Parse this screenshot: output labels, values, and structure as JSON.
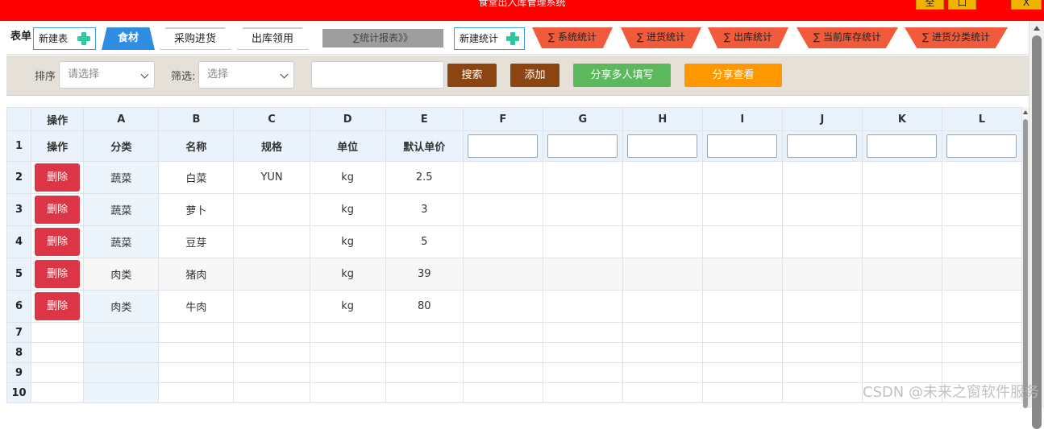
{
  "window": {
    "title": "食堂出入库管理系统",
    "btn_fullscreen": "全",
    "btn_max": "口",
    "btn_close": "X"
  },
  "tables_bar": {
    "label": "表单",
    "new_table": "新建表",
    "tabs": [
      "食材",
      "采购进货",
      "出库领用"
    ],
    "stats_report": "∑统计报表》》",
    "new_stat": "新建统计",
    "stats": [
      "∑ 系统统计",
      "∑ 进货统计",
      "∑ 出库统计",
      "∑ 当前库存统计",
      "∑ 进货分类统计"
    ]
  },
  "toolbar": {
    "sort_label": "排序",
    "sort_placeholder": "请选择",
    "filter_label": "筛选:",
    "filter_placeholder": "选择",
    "search_value": "",
    "search_btn": "搜索",
    "add_btn": "添加",
    "share_multi_btn": "分享多人填写",
    "share_view_btn": "分享查看",
    "colors": {
      "search": "#8b4513",
      "add": "#8b4513",
      "share_multi": "#5cb85c",
      "share_view": "#ff9800"
    }
  },
  "grid": {
    "col_letters": [
      "操作",
      "A",
      "B",
      "C",
      "D",
      "E",
      "F",
      "G",
      "H",
      "I",
      "J",
      "K",
      "L"
    ],
    "row1": {
      "num": "1",
      "cells": [
        "操作",
        "分类",
        "名称",
        "规格",
        "单位",
        "默认单价"
      ]
    },
    "delete_label": "删除",
    "rows": [
      {
        "num": "2",
        "A": "蔬菜",
        "B": "白菜",
        "C": "YUN",
        "D": "kg",
        "E": "2.5"
      },
      {
        "num": "3",
        "A": "蔬菜",
        "B": "萝卜",
        "C": "",
        "D": "kg",
        "E": "3"
      },
      {
        "num": "4",
        "A": "蔬菜",
        "B": "豆芽",
        "C": "",
        "D": "kg",
        "E": "5"
      },
      {
        "num": "5",
        "A": "肉类",
        "B": "猪肉",
        "C": "",
        "D": "kg",
        "E": "39"
      },
      {
        "num": "6",
        "A": "肉类",
        "B": "牛肉",
        "C": "",
        "D": "kg",
        "E": "80"
      }
    ],
    "empty_rows": [
      "7",
      "8",
      "9",
      "10"
    ]
  },
  "watermark": "CSDN @未来之窗软件服务"
}
